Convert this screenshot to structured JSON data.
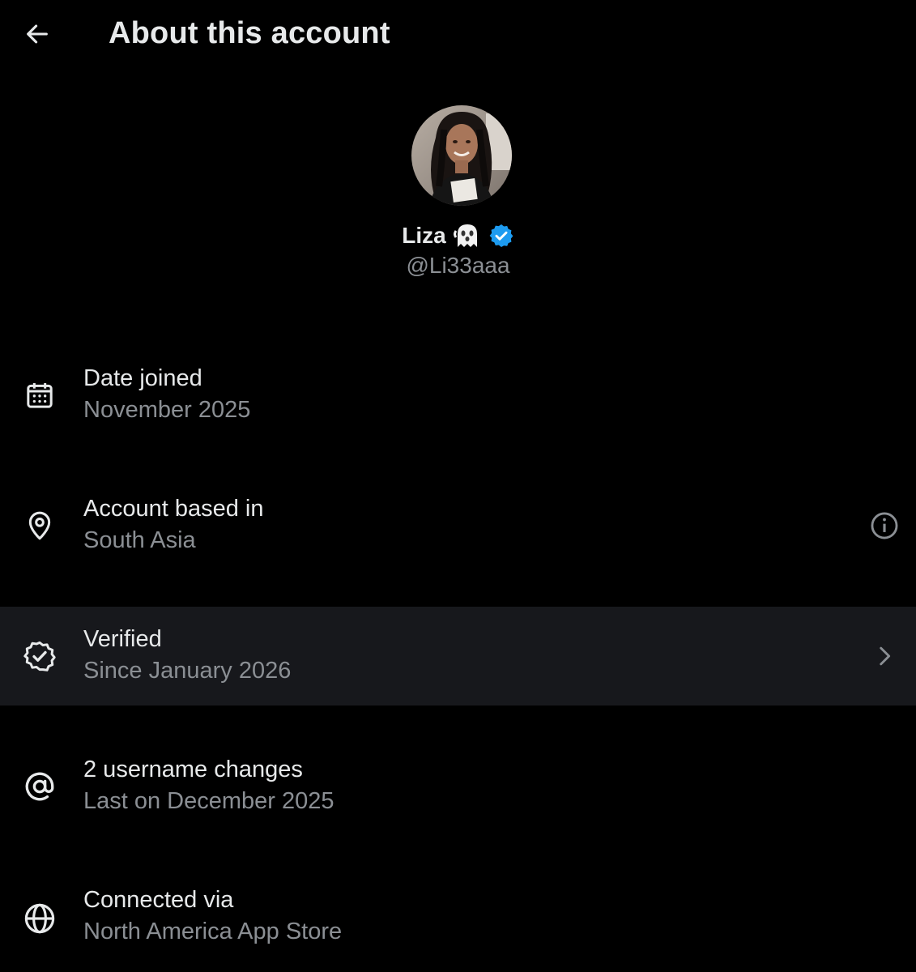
{
  "header": {
    "title": "About this account",
    "back_icon": "arrow-left-icon"
  },
  "profile": {
    "display_name": "Liza",
    "emoji": "ghost",
    "verified_badge_color": "#1d9bf0",
    "handle": "@Li33aaa"
  },
  "rows": [
    {
      "icon": "calendar-icon",
      "title": "Date joined",
      "subtitle": "November 2025"
    },
    {
      "icon": "location-pin-icon",
      "title": "Account based in",
      "subtitle": "South Asia",
      "action_icon": "info-icon"
    },
    {
      "icon": "verified-check-icon",
      "title": "Verified",
      "subtitle": "Since January 2026",
      "action_icon": "chevron-right-icon",
      "highlighted": true
    },
    {
      "icon": "at-sign-icon",
      "title": "2 username changes",
      "subtitle": "Last on December 2025"
    },
    {
      "icon": "globe-icon",
      "title": "Connected via",
      "subtitle": "North America App Store"
    }
  ],
  "colors": {
    "background": "#000000",
    "primary_text": "#e7e9ea",
    "secondary_text": "#8b8f94",
    "highlight_row": "#17181c",
    "accent": "#1d9bf0"
  }
}
